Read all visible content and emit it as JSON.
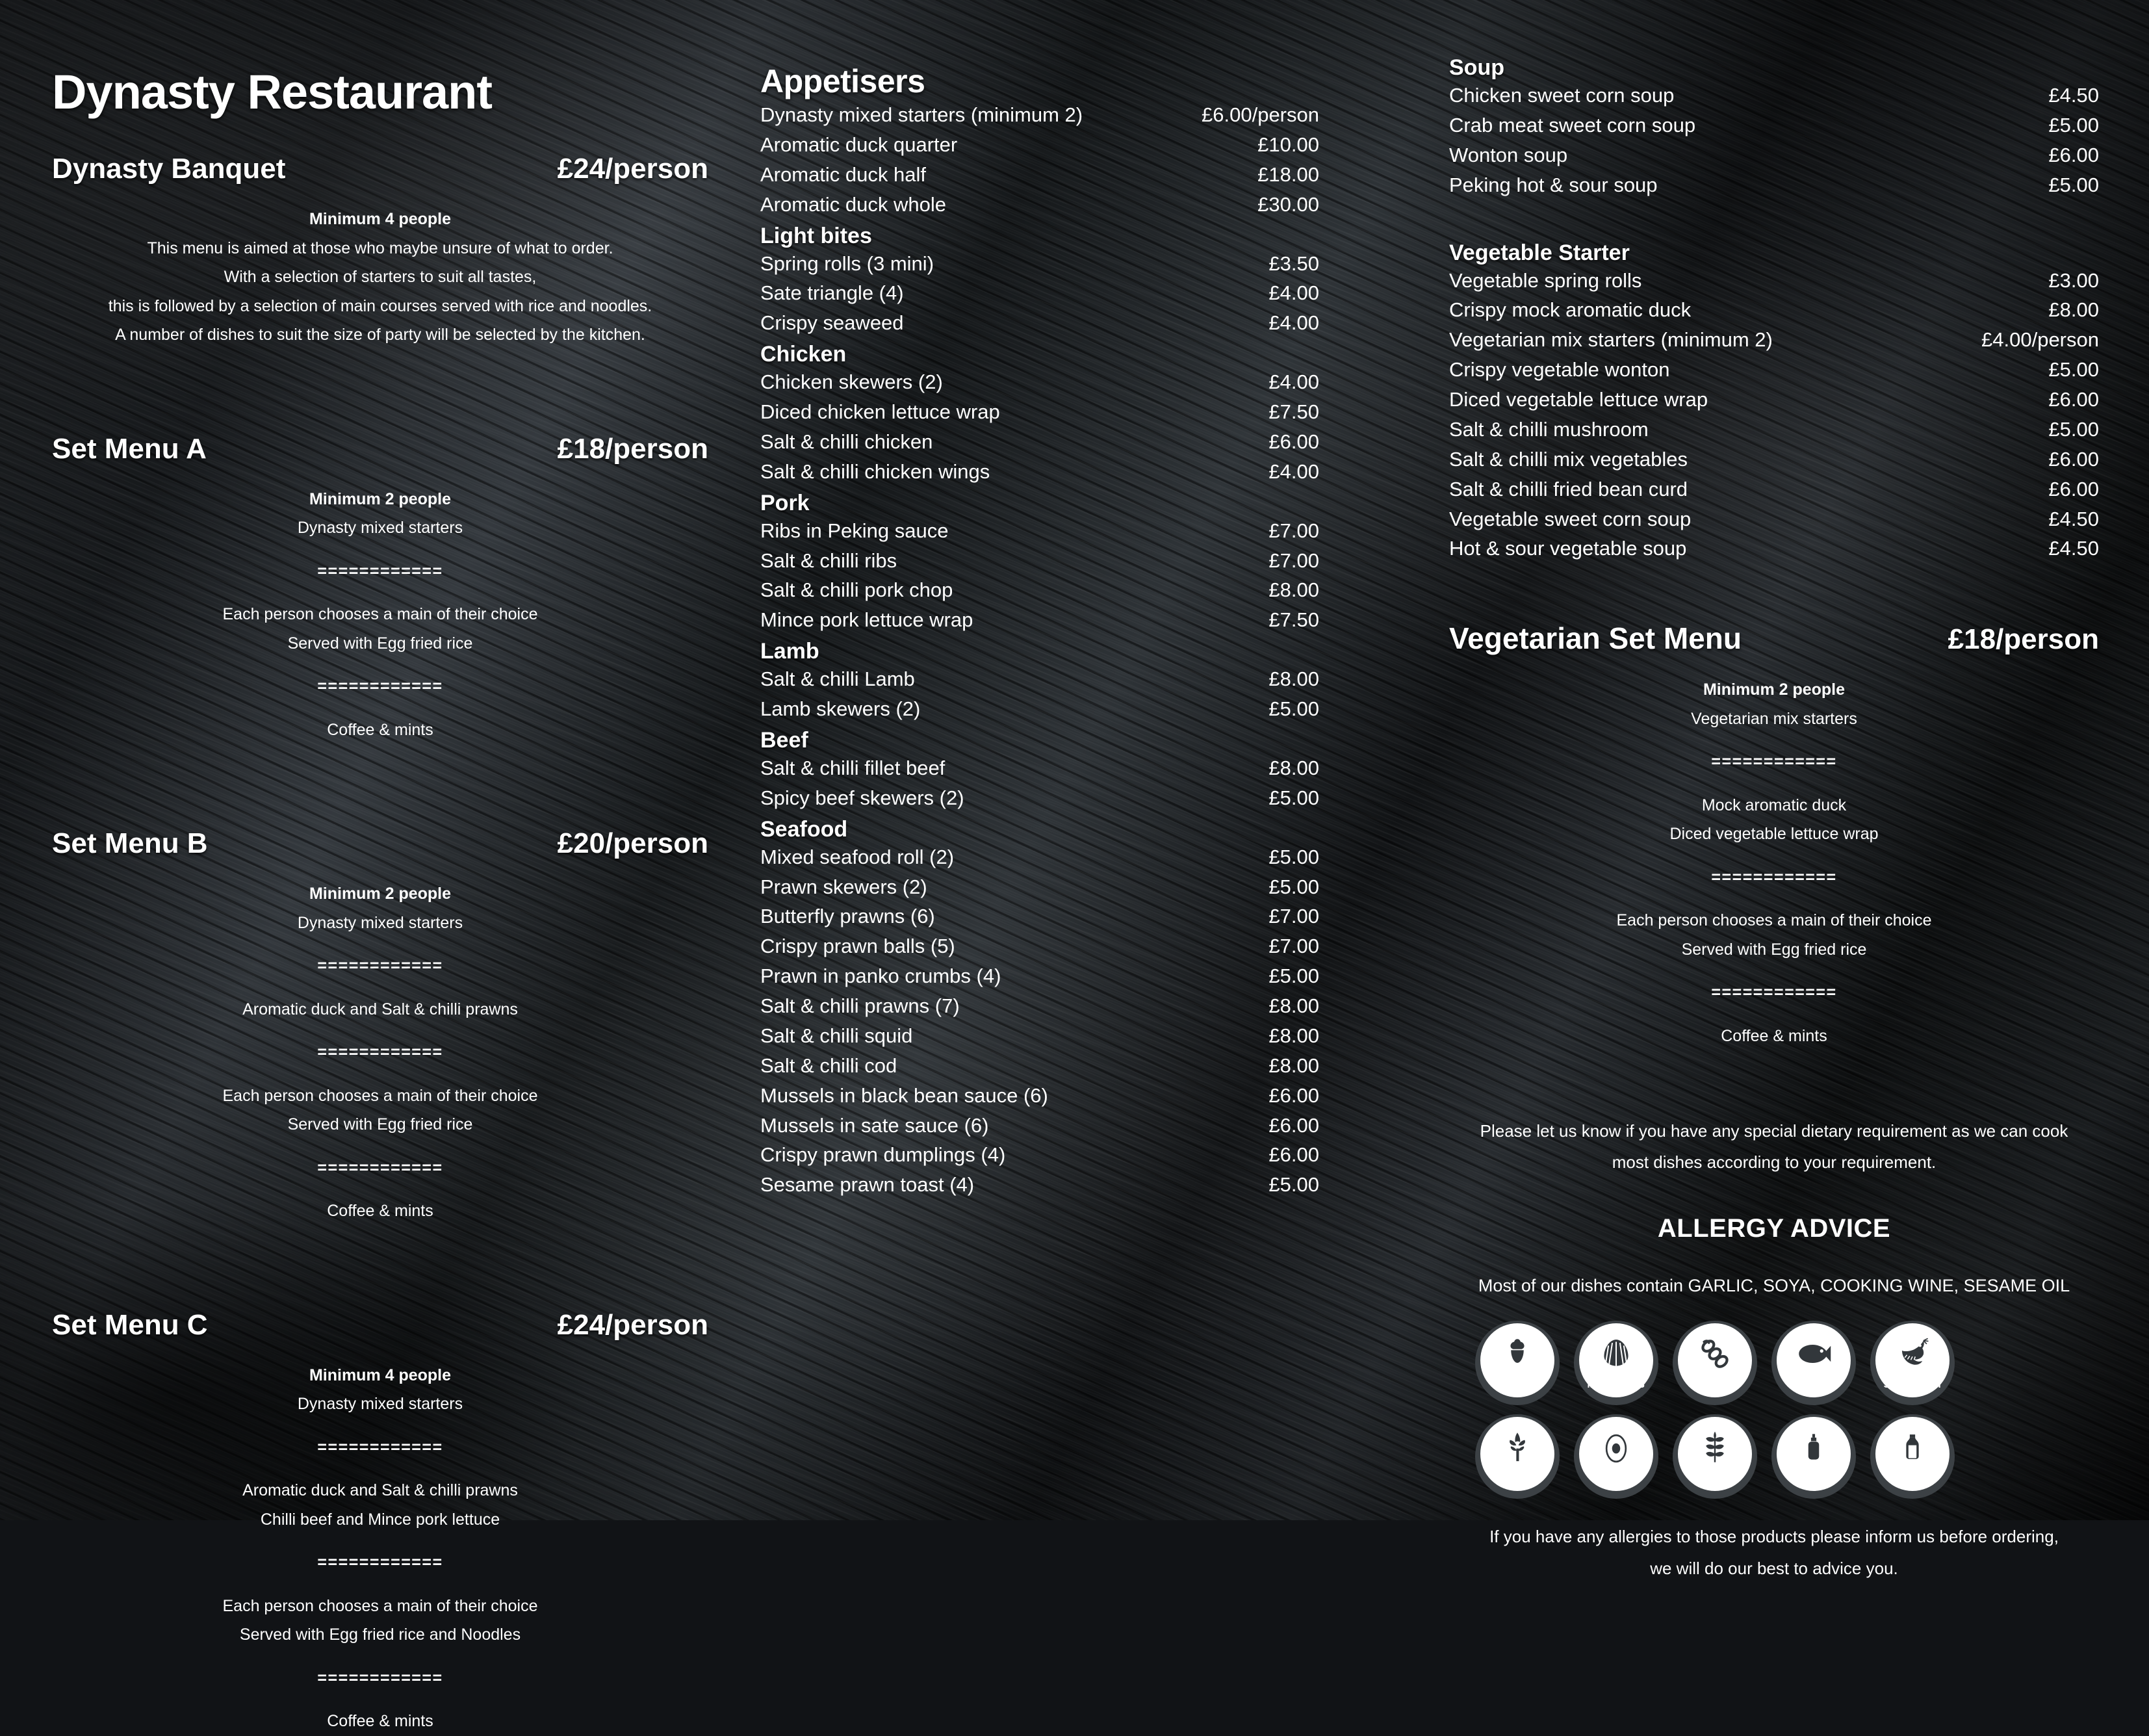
{
  "restaurant": {
    "name": "Dynasty Restaurant"
  },
  "set_menus": [
    {
      "title": "Dynasty Banquet",
      "price": "£24/person",
      "lines": [
        {
          "text": "Minimum 4 people",
          "style": "bold"
        },
        {
          "text": "This menu is aimed at those who maybe unsure of what to order.",
          "style": "normal"
        },
        {
          "text": "With a selection of starters to suit all tastes,",
          "style": "normal"
        },
        {
          "text": "this is followed by a selection of main courses served with rice and noodles.",
          "style": "normal"
        },
        {
          "text": "A number of dishes to suit the size of party will be selected by the kitchen.",
          "style": "normal"
        }
      ]
    },
    {
      "title": "Set Menu A",
      "price": "£18/person",
      "lines": [
        {
          "text": "Minimum 2 people",
          "style": "bold"
        },
        {
          "text": "Dynasty mixed starters",
          "style": "normal"
        },
        {
          "text": "",
          "style": "spacer"
        },
        {
          "text": "============",
          "style": "sep"
        },
        {
          "text": "",
          "style": "spacer"
        },
        {
          "text": "Each person chooses a main of their choice",
          "style": "normal"
        },
        {
          "text": "Served with Egg fried rice",
          "style": "normal"
        },
        {
          "text": "",
          "style": "spacer"
        },
        {
          "text": "============",
          "style": "sep"
        },
        {
          "text": "",
          "style": "spacer"
        },
        {
          "text": "Coffee & mints",
          "style": "normal"
        }
      ]
    },
    {
      "title": "Set Menu B",
      "price": "£20/person",
      "lines": [
        {
          "text": "Minimum 2 people",
          "style": "bold"
        },
        {
          "text": "Dynasty mixed starters",
          "style": "normal"
        },
        {
          "text": "",
          "style": "spacer"
        },
        {
          "text": "============",
          "style": "sep"
        },
        {
          "text": "",
          "style": "spacer"
        },
        {
          "text": "Aromatic duck and Salt & chilli prawns",
          "style": "normal"
        },
        {
          "text": "",
          "style": "spacer"
        },
        {
          "text": "============",
          "style": "sep"
        },
        {
          "text": "",
          "style": "spacer"
        },
        {
          "text": "Each person chooses a main of their choice",
          "style": "normal"
        },
        {
          "text": "Served with Egg fried rice",
          "style": "normal"
        },
        {
          "text": "",
          "style": "spacer"
        },
        {
          "text": "============",
          "style": "sep"
        },
        {
          "text": "",
          "style": "spacer"
        },
        {
          "text": "Coffee & mints",
          "style": "normal"
        }
      ]
    },
    {
      "title": "Set Menu C",
      "price": "£24/person",
      "lines": [
        {
          "text": "Minimum 4 people",
          "style": "bold"
        },
        {
          "text": "Dynasty mixed starters",
          "style": "normal"
        },
        {
          "text": "",
          "style": "spacer"
        },
        {
          "text": "============",
          "style": "sep"
        },
        {
          "text": "",
          "style": "spacer"
        },
        {
          "text": "Aromatic duck and Salt & chilli prawns",
          "style": "normal"
        },
        {
          "text": "Chilli beef and Mince pork lettuce",
          "style": "normal"
        },
        {
          "text": "",
          "style": "spacer"
        },
        {
          "text": "============",
          "style": "sep"
        },
        {
          "text": "",
          "style": "spacer"
        },
        {
          "text": "Each person chooses a main of their choice",
          "style": "normal"
        },
        {
          "text": "Served with Egg fried rice and Noodles",
          "style": "normal"
        },
        {
          "text": "",
          "style": "spacer"
        },
        {
          "text": "============",
          "style": "sep"
        },
        {
          "text": "",
          "style": "spacer"
        },
        {
          "text": "Coffee & mints",
          "style": "normal"
        }
      ]
    }
  ],
  "appetisers": {
    "title": "Appetisers",
    "items": [
      {
        "name": "Dynasty mixed starters (minimum 2)",
        "price": "£6.00/person"
      },
      {
        "name": "Aromatic duck quarter",
        "price": "£10.00"
      },
      {
        "name": "Aromatic duck half",
        "price": "£18.00"
      },
      {
        "name": "Aromatic duck whole",
        "price": "£30.00"
      }
    ],
    "groups": [
      {
        "title": "Light bites",
        "items": [
          {
            "name": "Spring rolls (3 mini)",
            "price": "£3.50"
          },
          {
            "name": "Sate triangle (4)",
            "price": "£4.00"
          },
          {
            "name": "Crispy seaweed",
            "price": "£4.00"
          }
        ]
      },
      {
        "title": "Chicken",
        "items": [
          {
            "name": "Chicken skewers (2)",
            "price": "£4.00"
          },
          {
            "name": "Diced chicken lettuce wrap",
            "price": "£7.50"
          },
          {
            "name": "Salt & chilli chicken",
            "price": "£6.00"
          },
          {
            "name": "Salt & chilli chicken wings",
            "price": "£4.00"
          }
        ]
      },
      {
        "title": "Pork",
        "items": [
          {
            "name": "Ribs in Peking sauce",
            "price": "£7.00"
          },
          {
            "name": "Salt & chilli ribs",
            "price": "£7.00"
          },
          {
            "name": "Salt & chilli pork chop",
            "price": "£8.00"
          },
          {
            "name": "Mince pork lettuce wrap",
            "price": "£7.50"
          }
        ]
      },
      {
        "title": "Lamb",
        "items": [
          {
            "name": "Salt & chilli Lamb",
            "price": "£8.00"
          },
          {
            "name": "Lamb skewers (2)",
            "price": "£5.00"
          }
        ]
      },
      {
        "title": "Beef",
        "items": [
          {
            "name": "Salt & chilli fillet beef",
            "price": "£8.00"
          },
          {
            "name": "Spicy beef skewers (2)",
            "price": "£5.00"
          }
        ]
      },
      {
        "title": "Seafood",
        "items": [
          {
            "name": "Mixed seafood roll (2)",
            "price": "£5.00"
          },
          {
            "name": "Prawn skewers (2)",
            "price": "£5.00"
          },
          {
            "name": "Butterfly prawns (6)",
            "price": "£7.00"
          },
          {
            "name": "Crispy prawn balls (5)",
            "price": "£7.00"
          },
          {
            "name": "Prawn in panko crumbs (4)",
            "price": "£5.00"
          },
          {
            "name": "Salt & chilli prawns (7)",
            "price": "£8.00"
          },
          {
            "name": "Salt & chilli squid",
            "price": "£8.00"
          },
          {
            "name": "Salt & chilli cod",
            "price": "£8.00"
          },
          {
            "name": "Mussels in black bean sauce (6)",
            "price": "£6.00"
          },
          {
            "name": "Mussels in sate sauce (6)",
            "price": "£6.00"
          },
          {
            "name": "Crispy prawn dumplings (4)",
            "price": "£6.00"
          },
          {
            "name": "Sesame prawn toast (4)",
            "price": "£5.00"
          }
        ]
      }
    ]
  },
  "soup": {
    "title": "Soup",
    "items": [
      {
        "name": "Chicken sweet corn soup",
        "price": "£4.50"
      },
      {
        "name": "Crab meat sweet corn soup",
        "price": "£5.00"
      },
      {
        "name": "Wonton soup",
        "price": "£6.00"
      },
      {
        "name": "Peking hot & sour soup",
        "price": "£5.00"
      }
    ]
  },
  "vegetable_starter": {
    "title": "Vegetable Starter",
    "items": [
      {
        "name": "Vegetable spring rolls",
        "price": "£3.00"
      },
      {
        "name": "Crispy mock aromatic duck",
        "price": "£8.00"
      },
      {
        "name": "Vegetarian mix starters (minimum 2)",
        "price": "£4.00/person"
      },
      {
        "name": "Crispy vegetable wonton",
        "price": "£5.00"
      },
      {
        "name": "Diced vegetable lettuce wrap",
        "price": "£6.00"
      },
      {
        "name": "Salt & chilli mushroom",
        "price": "£5.00"
      },
      {
        "name": "Salt & chilli mix vegetables",
        "price": "£6.00"
      },
      {
        "name": "Salt & chilli fried bean curd",
        "price": "£6.00"
      },
      {
        "name": "Vegetable sweet corn soup",
        "price": "£4.50"
      },
      {
        "name": "Hot & sour vegetable soup",
        "price": "£4.50"
      }
    ]
  },
  "vegetarian_set_menu": {
    "title": "Vegetarian Set Menu",
    "price": "£18/person",
    "lines": [
      {
        "text": "Minimum 2 people",
        "style": "bold"
      },
      {
        "text": "Vegetarian mix starters",
        "style": "normal"
      },
      {
        "text": "",
        "style": "spacer"
      },
      {
        "text": "============",
        "style": "sep"
      },
      {
        "text": "",
        "style": "spacer"
      },
      {
        "text": "Mock aromatic duck",
        "style": "normal"
      },
      {
        "text": "Diced vegetable lettuce wrap",
        "style": "normal"
      },
      {
        "text": "",
        "style": "spacer"
      },
      {
        "text": "============",
        "style": "sep"
      },
      {
        "text": "",
        "style": "spacer"
      },
      {
        "text": "Each person chooses a main of their choice",
        "style": "normal"
      },
      {
        "text": "Served with Egg fried rice",
        "style": "normal"
      },
      {
        "text": "",
        "style": "spacer"
      },
      {
        "text": "============",
        "style": "sep"
      },
      {
        "text": "",
        "style": "spacer"
      },
      {
        "text": "Coffee & mints",
        "style": "normal"
      }
    ]
  },
  "dietary_note": {
    "line1": "Please let us know if you have any special dietary requirement as we can cook",
    "line2": "most dishes according to your requirement."
  },
  "allergy": {
    "title": "ALLERGY ADVICE",
    "subtitle": "Most of our dishes contain GARLIC, SOYA, COOKING WINE, SESAME OIL",
    "badges": [
      {
        "label": "NUTS",
        "icon": "nut-icon"
      },
      {
        "label": "MOLLUSCS",
        "icon": "scallop-shell-icon"
      },
      {
        "label": "SOY",
        "icon": "soybean-pod-icon"
      },
      {
        "label": "FISH",
        "icon": "fish-icon"
      },
      {
        "label": "SHELLFISH",
        "icon": "prawn-icon"
      },
      {
        "label": "CELERY",
        "icon": "celery-icon"
      },
      {
        "label": "EGG",
        "icon": "egg-icon"
      },
      {
        "label": "GLUTEN",
        "icon": "wheat-icon"
      },
      {
        "label": "MUSTARD",
        "icon": "mustard-bottle-icon"
      },
      {
        "label": "LACTOSE",
        "icon": "milk-bottle-icon"
      }
    ],
    "footer_line1": "If you have any allergies to those products please inform us before ordering,",
    "footer_line2": "we will do our best to advice you."
  },
  "colors": {
    "text": "#ffffff",
    "slate_dark": "#111316",
    "badge_ring": "#3c4145",
    "badge_disc": "#ffffff"
  }
}
